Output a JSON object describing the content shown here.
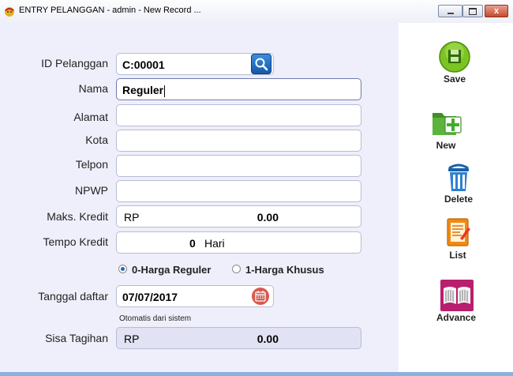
{
  "window": {
    "title": "ENTRY PELANGGAN - admin - New Record ...",
    "close_glyph": "x"
  },
  "form": {
    "id_label": "ID Pelanggan",
    "id_value": "C:00001",
    "nama_label": "Nama",
    "nama_value": "Reguler",
    "alamat_label": "Alamat",
    "alamat_value": "",
    "kota_label": "Kota",
    "kota_value": "",
    "telpon_label": "Telpon",
    "telpon_value": "",
    "npwp_label": "NPWP",
    "npwp_value": "",
    "maks_label": "Maks. Kredit",
    "maks_currency": "RP",
    "maks_value": "0.00",
    "tempo_label": "Tempo Kredit",
    "tempo_value": "0",
    "tempo_unit": "Hari",
    "harga_options": [
      "0-Harga Reguler",
      "1-Harga Khusus"
    ],
    "harga_selected": "0-Harga Reguler",
    "tanggal_label": "Tanggal daftar",
    "tanggal_value": "07/07/2017",
    "tanggal_note": "Otomatis dari sistem",
    "sisa_label": "Sisa Tagihan",
    "sisa_currency": "RP",
    "sisa_value": "0.00"
  },
  "sidebar": {
    "save_label": "Save",
    "new_label": "New",
    "delete_label": "Delete",
    "list_label": "List",
    "advance_label": "Advance"
  },
  "icons": [
    "app-icon",
    "search-icon",
    "calendar-icon",
    "save-icon",
    "new-folder-icon",
    "trash-icon",
    "list-icon",
    "book-icon"
  ],
  "colors": {
    "accent": "#1a60b8",
    "form_bg": "#efeffb",
    "sisa_bg": "#e2e2f5"
  }
}
